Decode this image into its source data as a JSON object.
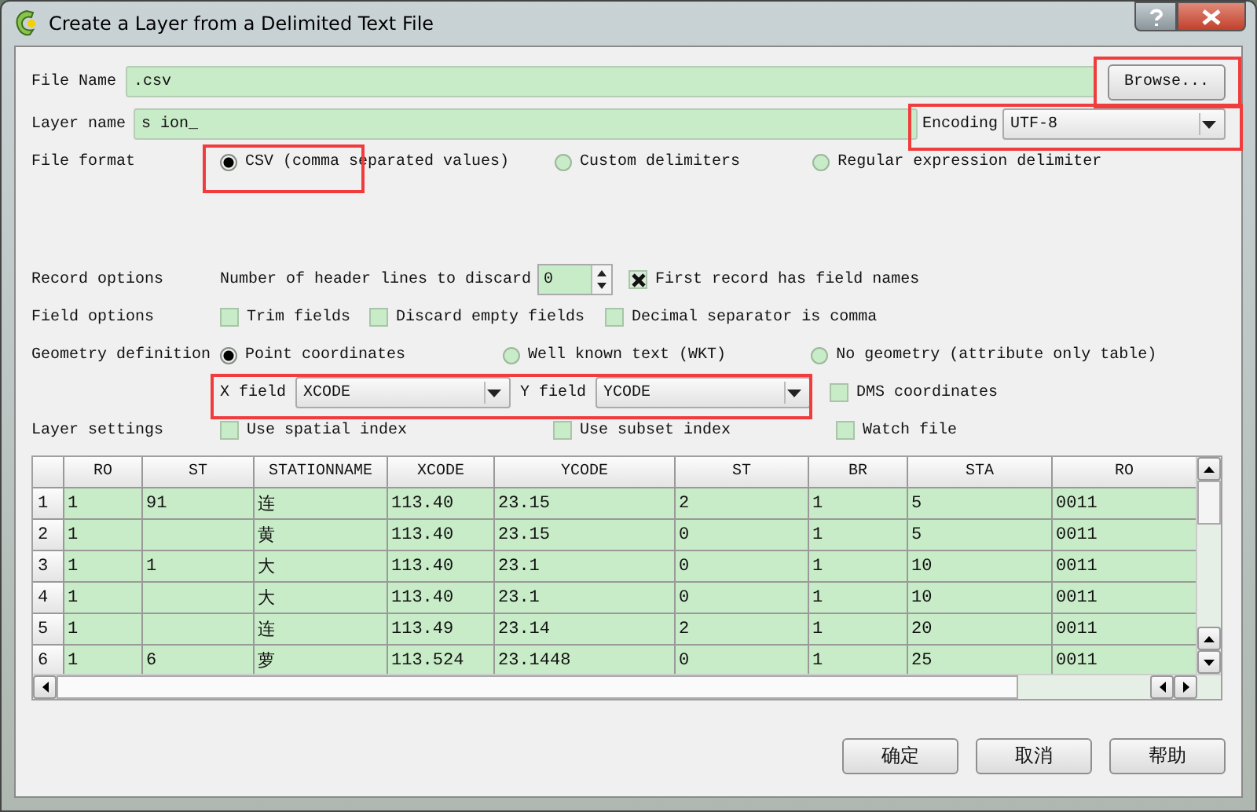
{
  "window": {
    "title": "Create a Layer from a Delimited Text File"
  },
  "file_name": {
    "label": "File Name",
    "value": ".csv"
  },
  "browse_button": "Browse...",
  "layer_name": {
    "label": "Layer name",
    "value": "s ion_"
  },
  "encoding": {
    "label": "Encoding",
    "value": "UTF-8"
  },
  "file_format": {
    "label": "File format",
    "options": [
      {
        "label": "CSV (comma separated values)",
        "selected": true
      },
      {
        "label": "Custom delimiters",
        "selected": false
      },
      {
        "label": "Regular expression delimiter",
        "selected": false
      }
    ]
  },
  "record_options": {
    "label": "Record options",
    "header_lines_label": "Number of header lines to discard",
    "header_lines": "0",
    "first_record": {
      "label": "First record has field names",
      "checked": true
    }
  },
  "field_options": {
    "label": "Field options",
    "options": [
      {
        "label": "Trim fields",
        "checked": false
      },
      {
        "label": "Discard empty fields",
        "checked": false
      },
      {
        "label": "Decimal separator is comma",
        "checked": false
      }
    ]
  },
  "geometry": {
    "label": "Geometry definition",
    "options": [
      {
        "label": "Point coordinates",
        "selected": true
      },
      {
        "label": "Well known text (WKT)",
        "selected": false
      },
      {
        "label": "No geometry (attribute only table)",
        "selected": false
      }
    ]
  },
  "x_field": {
    "label": "X field",
    "value": "XCODE"
  },
  "y_field": {
    "label": "Y field",
    "value": "YCODE"
  },
  "dms": {
    "label": "DMS coordinates",
    "checked": false
  },
  "layer_settings": {
    "label": "Layer settings",
    "options": [
      {
        "label": "Use spatial index",
        "checked": false
      },
      {
        "label": "Use subset index",
        "checked": false
      },
      {
        "label": "Watch file",
        "checked": false
      }
    ]
  },
  "table": {
    "columns": [
      "RO",
      "ST",
      "STATIONNAME",
      "XCODE",
      "YCODE",
      "ST",
      "BR",
      "STA",
      "RO"
    ],
    "rows": [
      {
        "number": "1",
        "cells": [
          "1",
          "91",
          "连",
          "113.40",
          "23.15",
          "2",
          "1",
          "5",
          "0011"
        ]
      },
      {
        "number": "2",
        "cells": [
          "1",
          null,
          "黄",
          "113.40",
          "23.15",
          "0",
          "1",
          "5",
          "0011"
        ]
      },
      {
        "number": "3",
        "cells": [
          "1",
          "1",
          "大",
          "113.40",
          "23.1",
          "0",
          "1",
          "10",
          "0011"
        ]
      },
      {
        "number": "4",
        "cells": [
          "1",
          null,
          "大",
          "113.40",
          "23.1",
          "0",
          "1",
          "10",
          "0011"
        ]
      },
      {
        "number": "5",
        "cells": [
          "1",
          null,
          "连",
          "113.49",
          "23.14",
          "2",
          "1",
          "20",
          "0011"
        ]
      },
      {
        "number": "6",
        "cells": [
          "1",
          "6",
          "萝",
          "113.524",
          "23.1448",
          "0",
          "1",
          "25",
          "0011"
        ]
      }
    ]
  },
  "buttons": [
    "确定",
    "取消",
    "帮助"
  ]
}
